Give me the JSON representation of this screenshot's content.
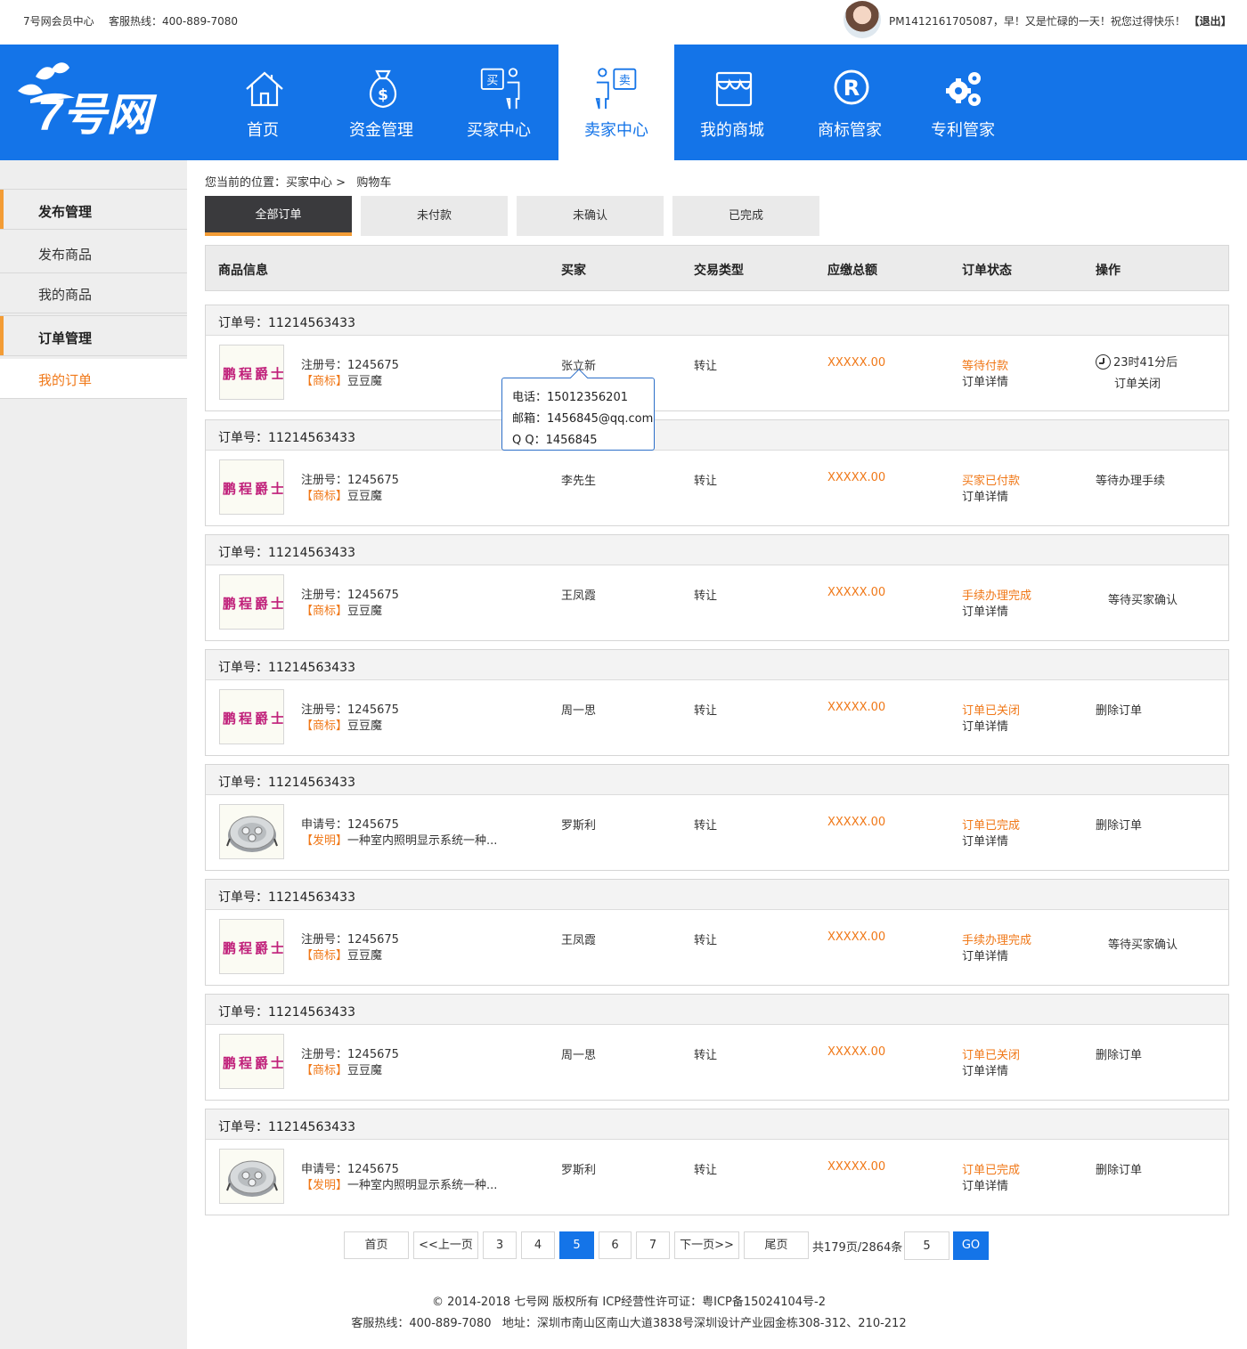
{
  "topbar": {
    "brand": "7号网会员中心",
    "hotline": "客服热线：400-889-7080",
    "greeting": "PM1412161705087，早！又是忙碌的一天！祝您过得快乐！",
    "logout": "【退出】"
  },
  "logo": {
    "text": "7号网"
  },
  "nav": {
    "items": [
      {
        "label": "首页",
        "icon": "home-icon"
      },
      {
        "label": "资金管理",
        "icon": "money-bag-icon"
      },
      {
        "label": "买家中心",
        "icon": "buyer-icon"
      },
      {
        "label": "卖家中心",
        "icon": "seller-icon",
        "active": true
      },
      {
        "label": "我的商城",
        "icon": "store-icon"
      },
      {
        "label": "商标管家",
        "icon": "registered-icon"
      },
      {
        "label": "专利管家",
        "icon": "gears-icon"
      }
    ]
  },
  "sidebar": {
    "group1": "发布管理",
    "item1": "发布商品",
    "item2": "我的商品",
    "group2": "订单管理",
    "item3": "我的订单"
  },
  "breadcrumb": "您当前的位置：买家中心 >   购物车",
  "tabs": [
    "全部订单",
    "未付款",
    "未确认",
    "已完成"
  ],
  "table_header": {
    "product": "商品信息",
    "buyer": "买家",
    "type": "交易类型",
    "amount": "应缴总额",
    "status": "订单状态",
    "action": "操作"
  },
  "orders": [
    {
      "order_no": "订单号：11214563433",
      "thumb": "鹏程爵士",
      "reg": "注册号：1245675",
      "cat": "【商标】",
      "name": "豆豆魔",
      "buyer": "张立新",
      "type": "转让",
      "amount": "XXXXX.00",
      "status": "等待付款",
      "detail": "订单详情",
      "op_timer": "23时41分后",
      "op": "订单关闭"
    },
    {
      "order_no": "订单号：11214563433",
      "thumb": "鹏程爵士",
      "reg": "注册号：1245675",
      "cat": "【商标】",
      "name": "豆豆魔",
      "buyer": "李先生",
      "type": "转让",
      "amount": "XXXXX.00",
      "status": "买家已付款",
      "detail": "订单详情",
      "op": "等待办理手续"
    },
    {
      "order_no": "订单号：11214563433",
      "thumb": "鹏程爵士",
      "reg": "注册号：1245675",
      "cat": "【商标】",
      "name": "豆豆魔",
      "buyer": "王凤霞",
      "type": "转让",
      "amount": "XXXXX.00",
      "status": "手续办理完成",
      "detail": "订单详情",
      "op": "等待买家确认"
    },
    {
      "order_no": "订单号：11214563433",
      "thumb": "鹏程爵士",
      "reg": "注册号：1245675",
      "cat": "【商标】",
      "name": "豆豆魔",
      "buyer": "周一思",
      "type": "转让",
      "amount": "XXXXX.00",
      "status": "订单已关闭",
      "detail": "订单详情",
      "op": "删除订单"
    },
    {
      "order_no": "订单号：11214563433",
      "thumb": "",
      "reg": "申请号：1245675",
      "cat": "【发明】",
      "name": "一种室内照明显示系统一种...",
      "buyer": "罗斯利",
      "type": "转让",
      "amount": "XXXXX.00",
      "status": "订单已完成",
      "detail": "订单详情",
      "op": "删除订单"
    },
    {
      "order_no": "订单号：11214563433",
      "thumb": "鹏程爵士",
      "reg": "注册号：1245675",
      "cat": "【商标】",
      "name": "豆豆魔",
      "buyer": "王凤霞",
      "type": "转让",
      "amount": "XXXXX.00",
      "status": "手续办理完成",
      "detail": "订单详情",
      "op": "等待买家确认"
    },
    {
      "order_no": "订单号：11214563433",
      "thumb": "鹏程爵士",
      "reg": "注册号：1245675",
      "cat": "【商标】",
      "name": "豆豆魔",
      "buyer": "周一思",
      "type": "转让",
      "amount": "XXXXX.00",
      "status": "订单已关闭",
      "detail": "订单详情",
      "op": "删除订单"
    },
    {
      "order_no": "订单号：11214563433",
      "thumb": "",
      "reg": "申请号：1245675",
      "cat": "【发明】",
      "name": "一种室内照明显示系统一种...",
      "buyer": "罗斯利",
      "type": "转让",
      "amount": "XXXXX.00",
      "status": "订单已完成",
      "detail": "订单详情",
      "op": "删除订单"
    }
  ],
  "tooltip": {
    "phone": "电话：15012356201",
    "email": "邮箱：1456845@qq.com",
    "qq": "Q Q：1456845"
  },
  "pager": {
    "first": "首页",
    "prev": "<<上一页",
    "p3": "3",
    "p4": "4",
    "p5": "5",
    "p6": "6",
    "p7": "7",
    "next": "下一页>>",
    "last": "尾页",
    "info": "共179页/2864条",
    "input_value": "5",
    "go": "GO"
  },
  "footer": {
    "line1": "© 2014-2018 七号网 版权所有 ICP经营性许可证：粤ICP备15024104号-2",
    "line2": "客服热线：400-889-7080   地址：深圳市南山区南山大道3838号深圳设计产业园金栋308-312、210-212"
  },
  "colors": {
    "primary": "#1474e8",
    "accent": "#f07818",
    "tab_dark": "#3a3a3d",
    "tab_underline": "#f39c35"
  }
}
